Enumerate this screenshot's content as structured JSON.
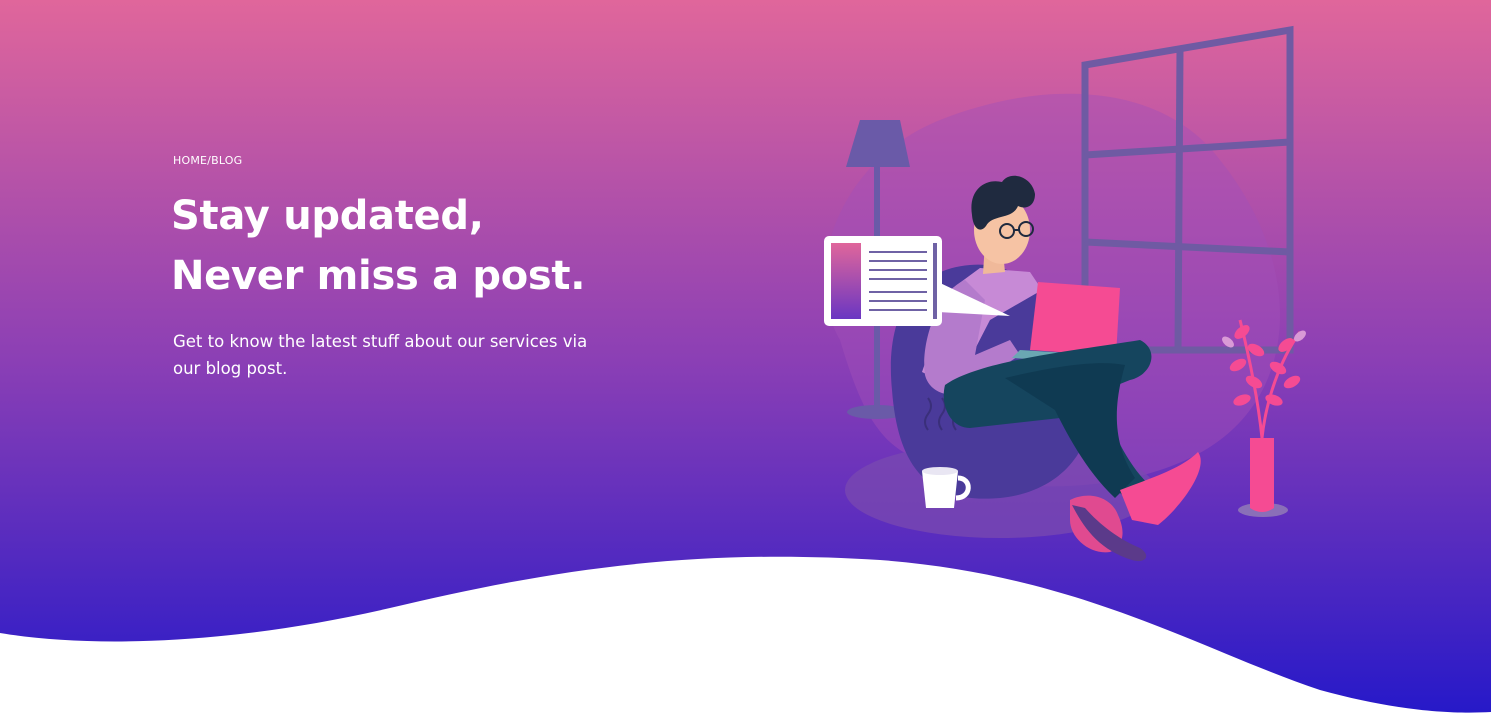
{
  "breadcrumb": {
    "home": "HOME",
    "separator": "/",
    "current": "BLOG"
  },
  "hero": {
    "title_line1": "Stay updated,",
    "title_line2": "Never miss a post.",
    "subtitle": "Get to know the latest stuff about our services via our blog post."
  },
  "colors": {
    "gradient_top": "#e0669b",
    "gradient_mid": "#8b3fb5",
    "gradient_bottom": "#2418c9",
    "accent_pink": "#f54b93",
    "beanbag": "#4a3a9a"
  },
  "icons": [
    "reader-illustration",
    "article-card-icon",
    "laptop-icon",
    "coffee-cup-icon",
    "floor-lamp-icon",
    "plant-vase-icon",
    "window-icon"
  ]
}
